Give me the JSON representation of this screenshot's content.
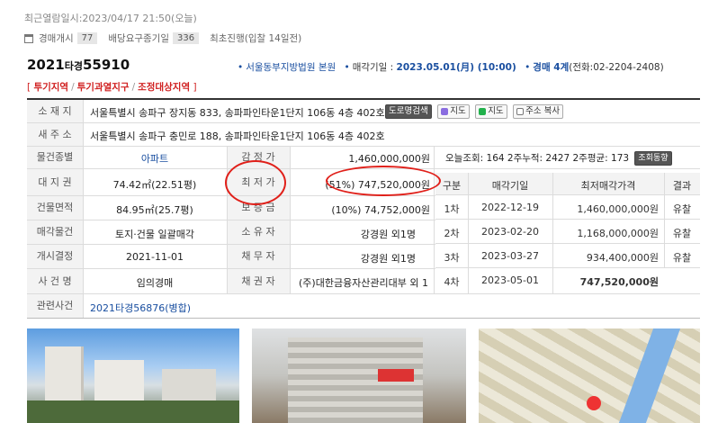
{
  "recent": "최근열람일시:2023/04/17 21:50(오늘)",
  "stats": {
    "auction_open_label": "경매개시",
    "auction_open_count": "77",
    "dividend_label": "배당요구종기일",
    "dividend_count": "336",
    "latest_label": "최초진행(입찰 14일전)"
  },
  "case": {
    "year": "2021",
    "type": "타경",
    "num": "55910"
  },
  "court": {
    "name": "서울동부지방법원 본원",
    "sale_label": "매각기일 : ",
    "sale_date": "2023.05.01(月) (10:00)",
    "dept": "경매 4계",
    "phone": "(전화:02-2204-2408)"
  },
  "tags": [
    "투기지역",
    "투기과열지구",
    "조정대상지역"
  ],
  "labels": {
    "location": "소 재 지",
    "new_addr": "새 주 소",
    "kind": "물건종별",
    "land": "대 지 권",
    "area": "건물면적",
    "sale_obj": "매각물건",
    "decision": "개시결정",
    "case_name": "사 건 명",
    "related": "관련사건",
    "appraisal": "감 정 가",
    "minimum": "최 저 가",
    "deposit": "보 증 금",
    "owner": "소 유 자",
    "debtor": "채 무 자",
    "creditor": "채 권 자"
  },
  "values": {
    "location": "서울특별시 송파구 장지동 833, 송파파인타운1단지 106동 4층 402호",
    "new_addr": "서울특별시 송파구 충민로 188, 송파파인타운1단지 106동 4층 402호",
    "kind": "아파트",
    "land": "74.42㎡(22.51평)",
    "area": "84.95㎡(25.7평)",
    "sale_obj": "토지·건물 일괄매각",
    "decision": "2021-11-01",
    "case_name": "임의경매",
    "related": "2021타경56876(병합)",
    "appraisal": "1,460,000,000원",
    "minimum": "(51%) 747,520,000원",
    "deposit": "(10%) 74,752,000원",
    "owner": "강경원 외1명",
    "debtor": "강경원 외1명",
    "creditor": "(주)대한금융자산관리대부 외 1"
  },
  "buttons": {
    "road": "도로명검색",
    "map1": "지도",
    "map2": "지도",
    "copy": "주소 복사",
    "trend": "조회동향"
  },
  "views": "오늘조회: 164  2주누적: 2427  2주평균: 173",
  "history": {
    "headers": [
      "구분",
      "매각기일",
      "최저매각가격",
      "결과"
    ],
    "rows": [
      {
        "round": "1차",
        "date": "2022-12-19",
        "price": "1,460,000,000원",
        "result": "유찰"
      },
      {
        "round": "2차",
        "date": "2023-02-20",
        "price": "1,168,000,000원",
        "result": "유찰"
      },
      {
        "round": "3차",
        "date": "2023-03-27",
        "price": "934,400,000원",
        "result": "유찰"
      },
      {
        "round": "4차",
        "date": "2023-05-01",
        "price": "747,520,000원",
        "result": ""
      }
    ]
  },
  "colors": {
    "accent_blue": "#1a4fa0",
    "tag_red": "#d02020",
    "circle_red": "#e0201a"
  }
}
